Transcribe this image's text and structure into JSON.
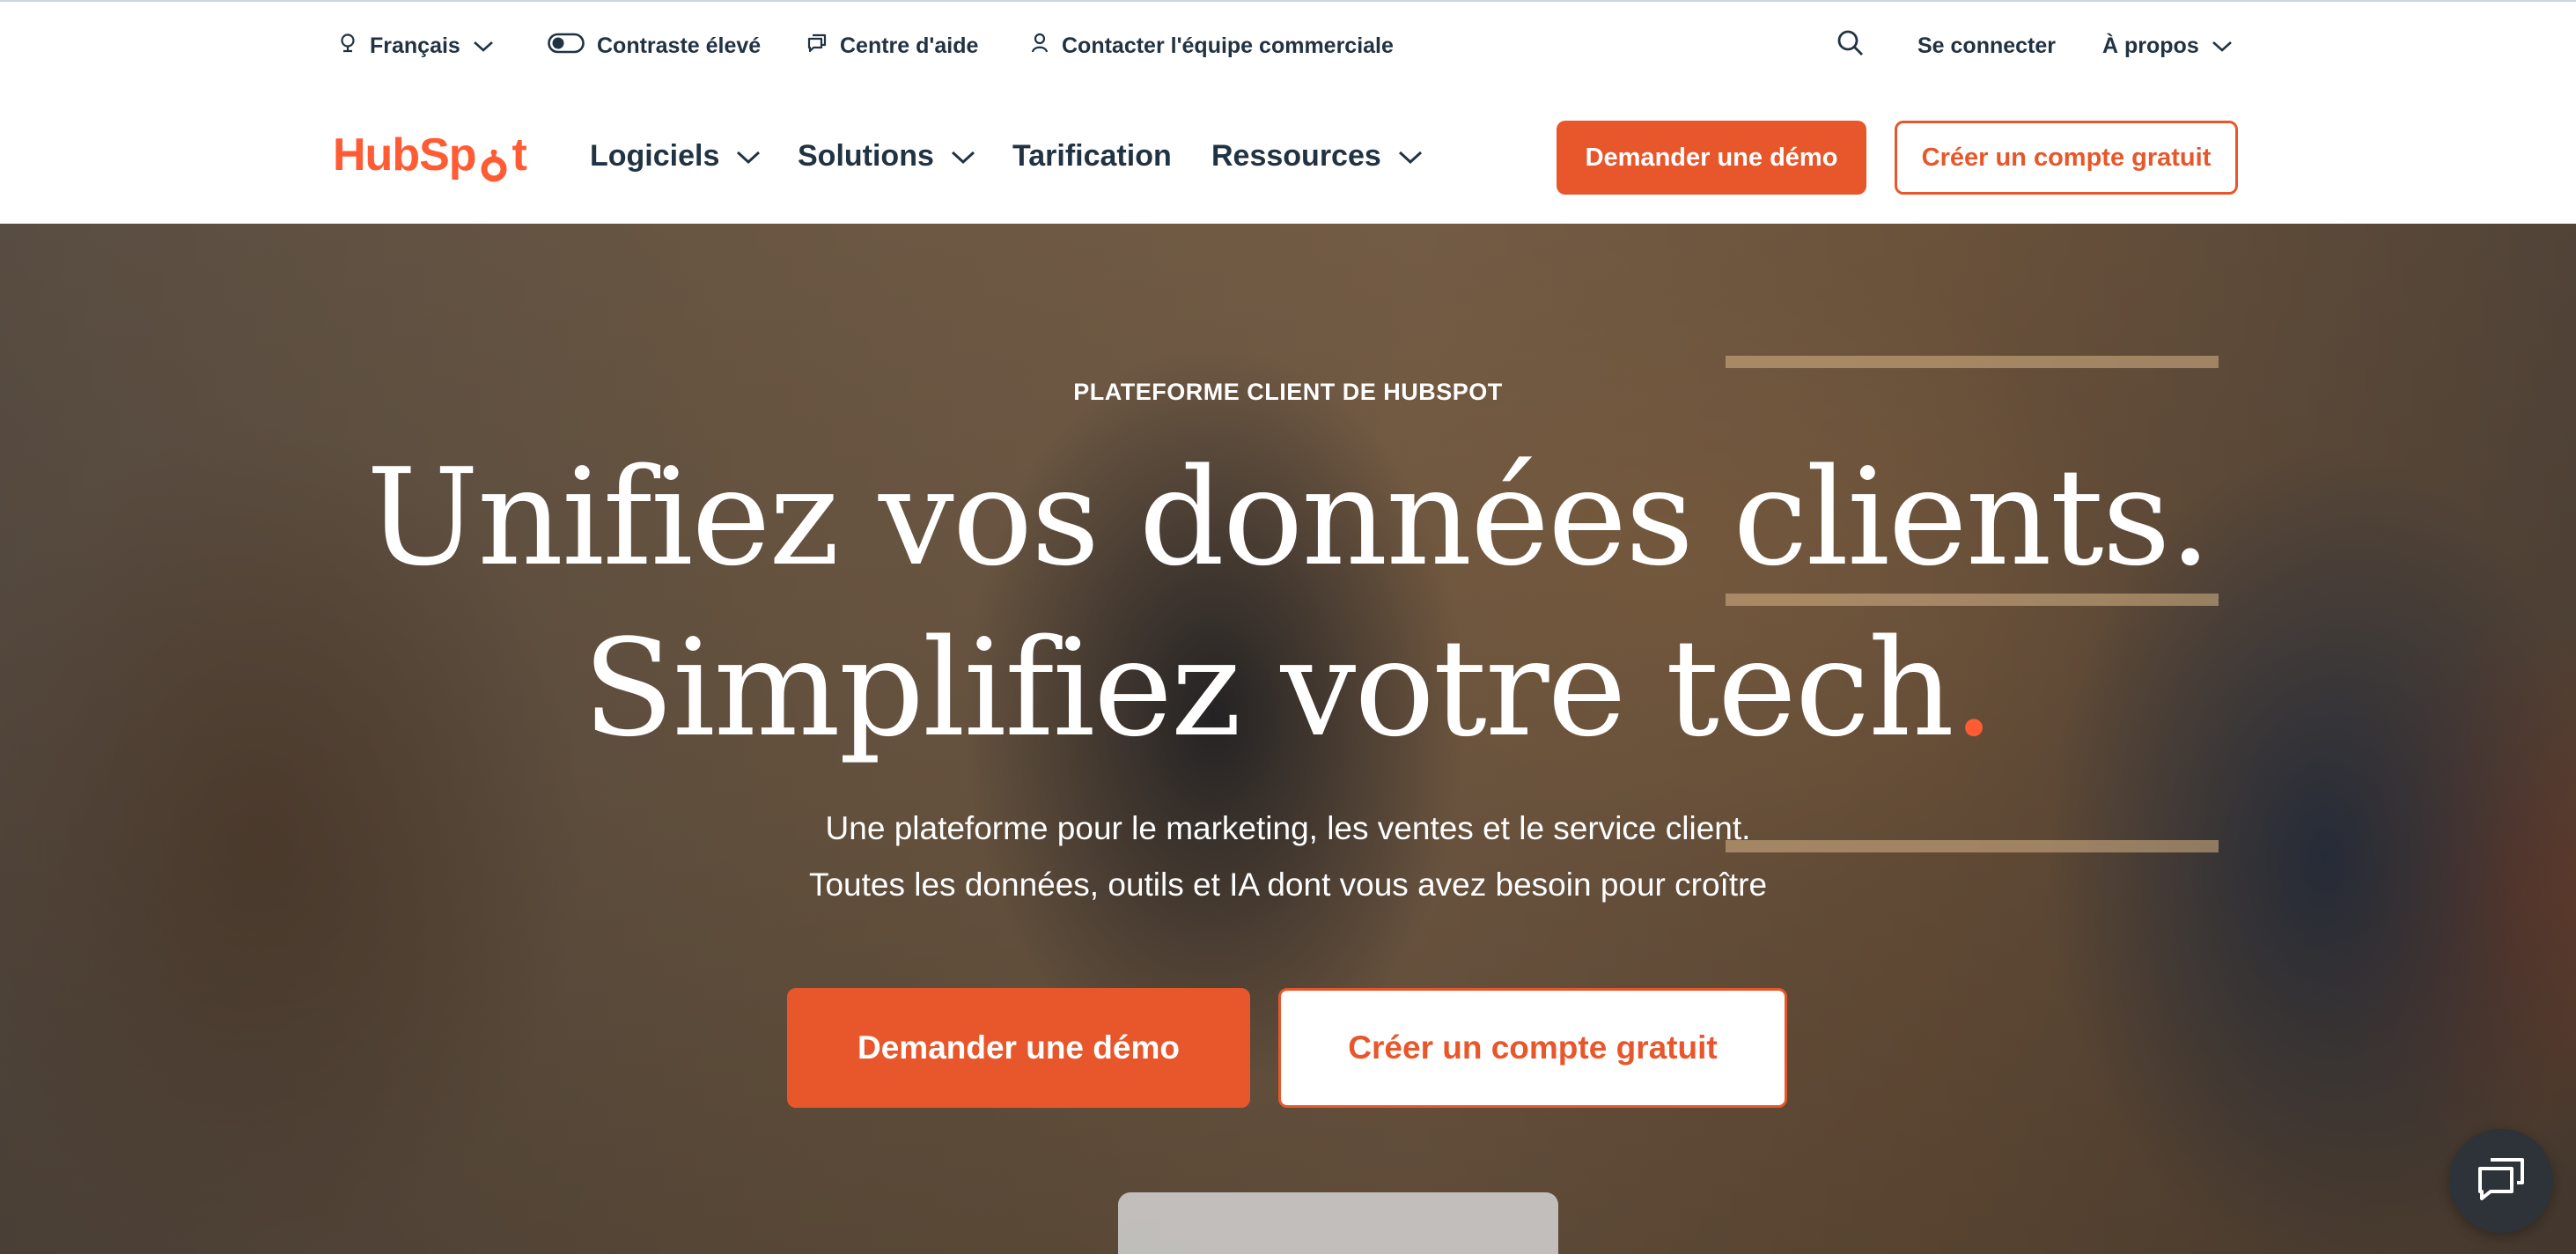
{
  "utility": {
    "language": "Français",
    "contrast": "Contraste élevé",
    "help": "Centre d'aide",
    "contact": "Contacter l'équipe commerciale",
    "login": "Se connecter",
    "about": "À propos"
  },
  "nav": {
    "logo": "HubSpot",
    "items": [
      {
        "label": "Logiciels",
        "dropdown": true
      },
      {
        "label": "Solutions",
        "dropdown": true
      },
      {
        "label": "Tarification",
        "dropdown": false
      },
      {
        "label": "Ressources",
        "dropdown": true
      }
    ],
    "demo_button": "Demander une démo",
    "signup_button": "Créer un compte gratuit"
  },
  "hero": {
    "eyebrow": "PLATEFORME CLIENT DE HUBSPOT",
    "headline_1": "Unifiez vos données clients.",
    "headline_2": "Simplifiez votre tech",
    "headline_2_end": ".",
    "sub_1": "Une plateforme pour le marketing, les ventes et le service client.",
    "sub_2": "Toutes les données, outils et IA dont vous avez besoin pour croître",
    "demo_button": "Demander une démo",
    "signup_button": "Créer un compte gratuit"
  },
  "colors": {
    "brand": "#ff5c35",
    "button": "#e8572b",
    "text": "#213343"
  },
  "icons": [
    "globe-icon",
    "toggle-icon",
    "chat-icon",
    "person-icon",
    "search-icon",
    "chevron-down-icon",
    "chat-bubble-icon"
  ]
}
